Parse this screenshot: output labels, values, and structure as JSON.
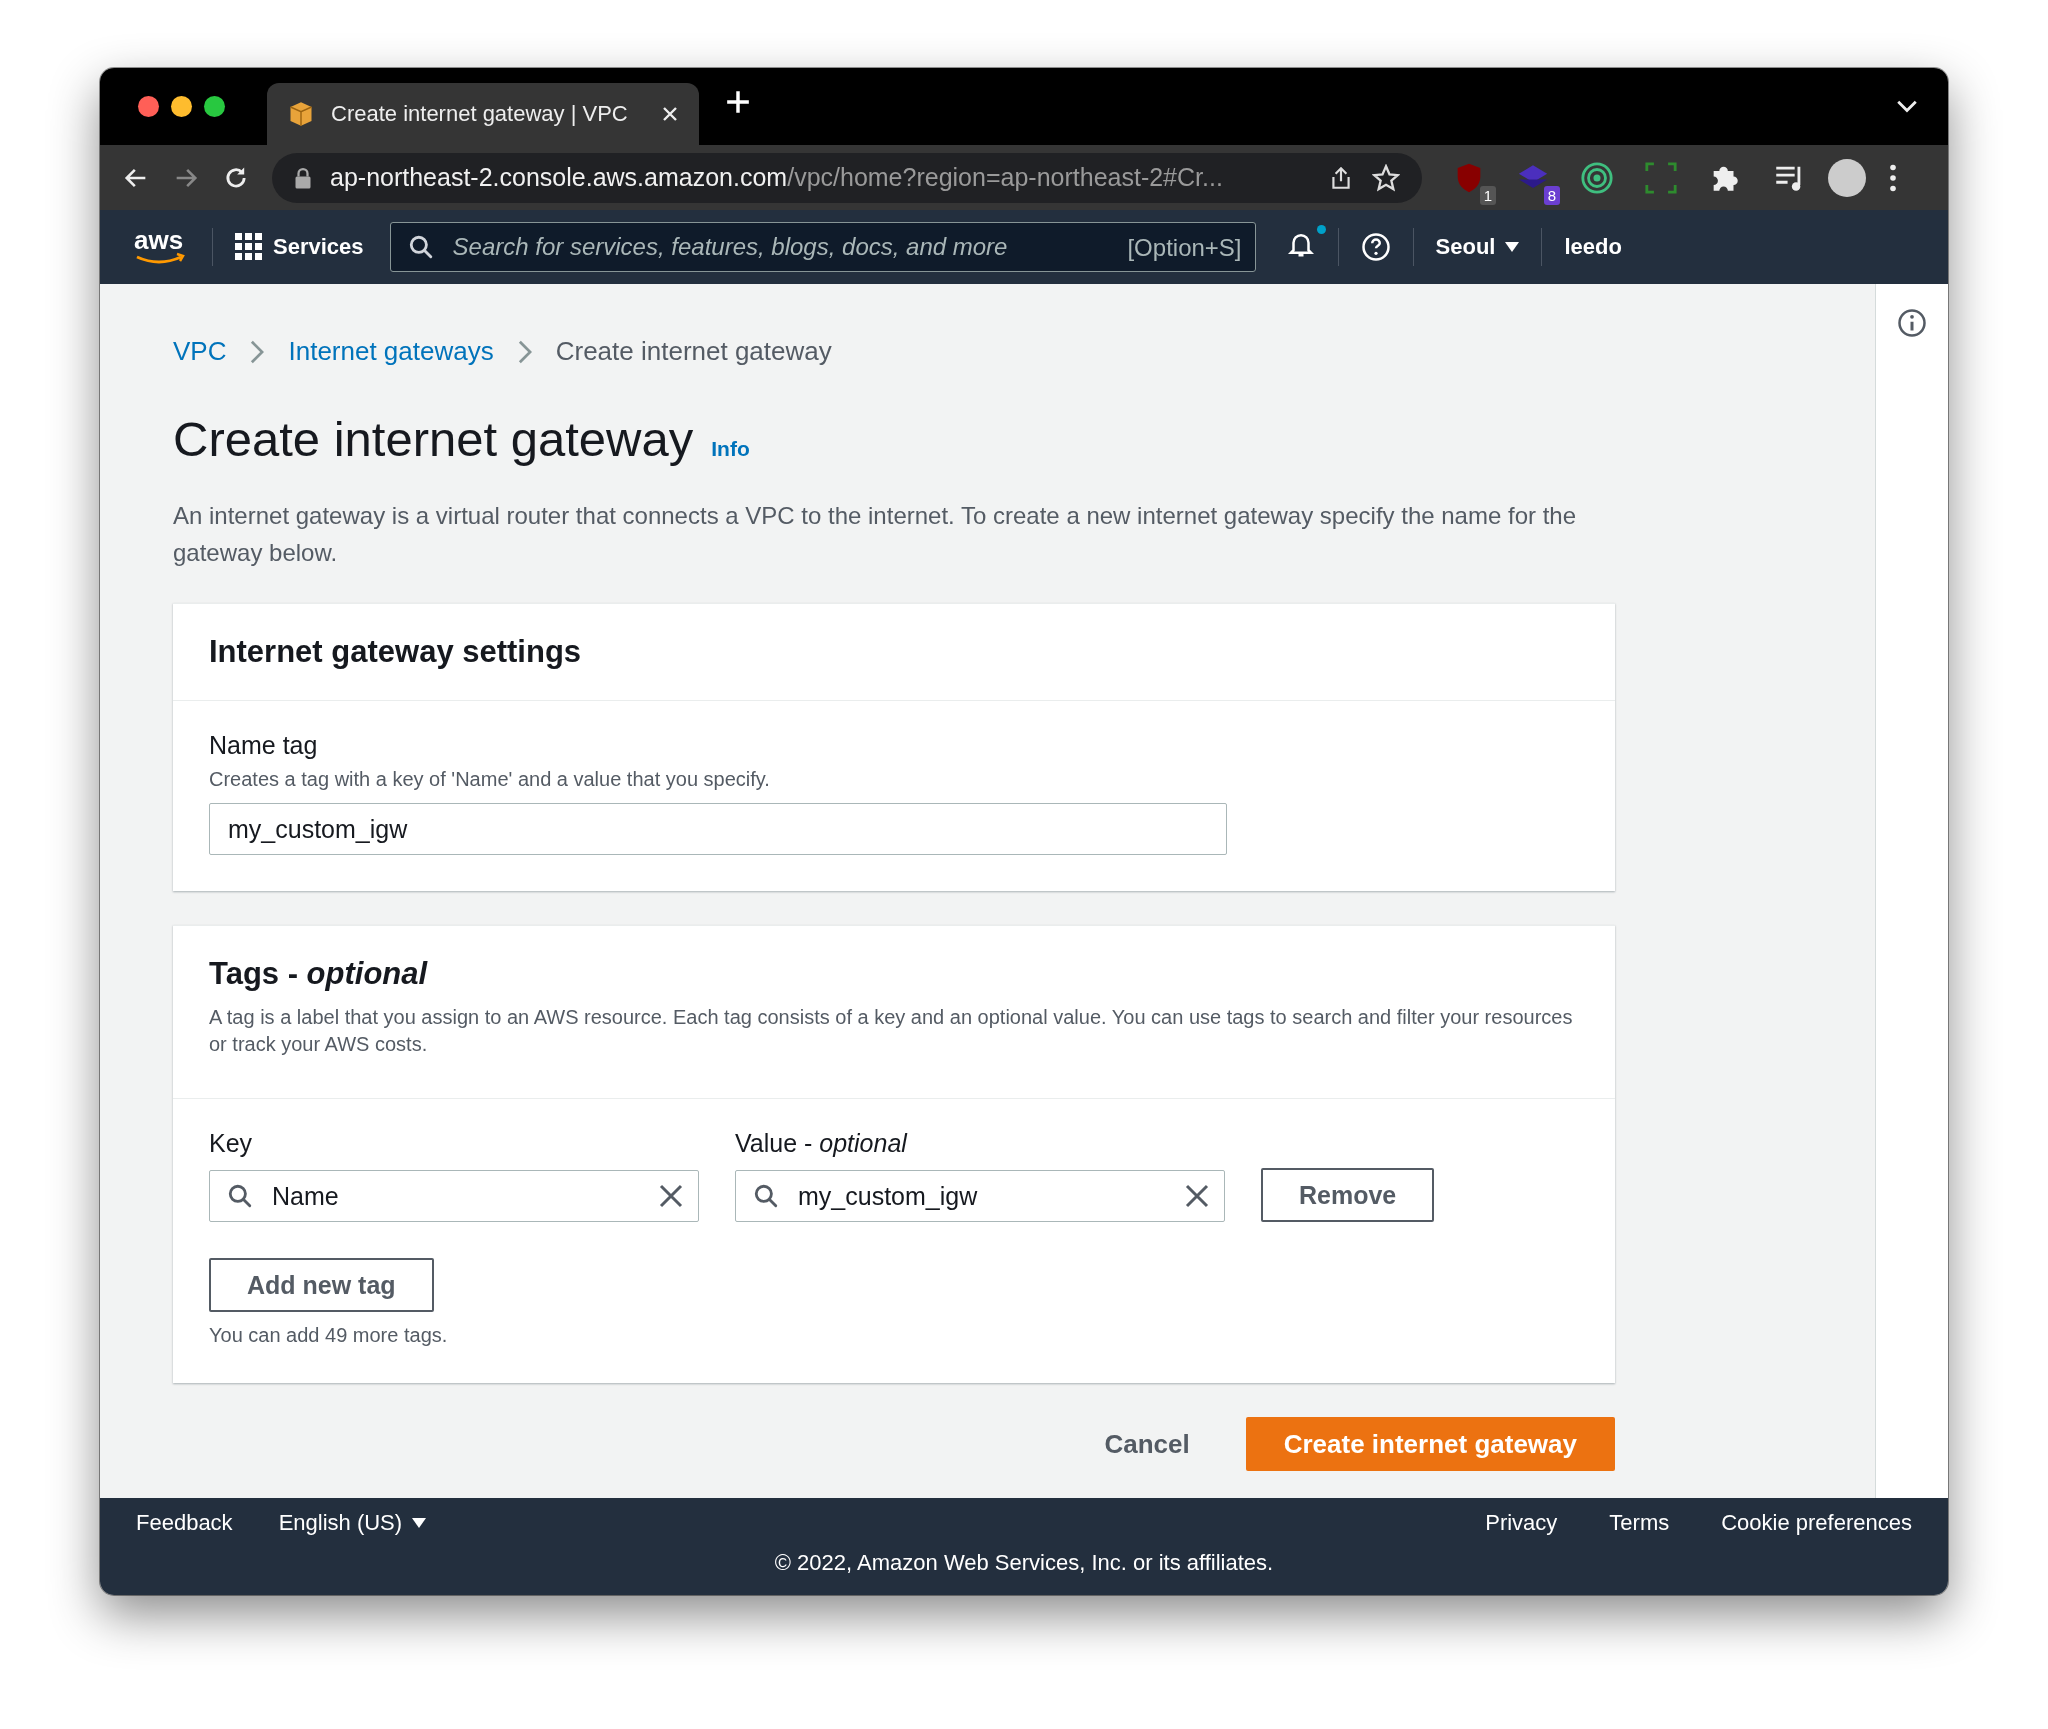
{
  "browser": {
    "tab": {
      "title": "Create internet gateway | VPC",
      "selected": true
    },
    "address": {
      "host": "ap-northeast-2.console.aws.amazon.com",
      "path": "/vpc/home?region=ap-northeast-2#Cr..."
    },
    "extensions": [
      {
        "kind": "shield",
        "badge": "1"
      },
      {
        "kind": "stack",
        "badge": "8"
      },
      {
        "kind": "target"
      },
      {
        "kind": "frame"
      },
      {
        "kind": "puzzle"
      },
      {
        "kind": "playlist"
      }
    ]
  },
  "console_nav": {
    "logo": "aws",
    "services": "Services",
    "search": {
      "placeholder": "Search for services, features, blogs, docs, and more",
      "shortcut": "[Option+S]"
    },
    "notifications_unread": true,
    "region": "Seoul",
    "user": "leedo"
  },
  "breadcrumbs": [
    {
      "label": "VPC",
      "link": true
    },
    {
      "label": "Internet gateways",
      "link": true
    },
    {
      "label": "Create internet gateway",
      "link": false
    }
  ],
  "title": "Create internet gateway",
  "info": "Info",
  "description": "An internet gateway is a virtual router that connects a VPC to the internet. To create a new internet gateway specify the name for the gateway below.",
  "settings": {
    "heading": "Internet gateway settings",
    "name_tag": {
      "label": "Name tag",
      "hint": "Creates a tag with a key of 'Name' and a value that you specify.",
      "value": "my_custom_igw"
    }
  },
  "tags": {
    "heading": "Tags - *optional*",
    "description": "A tag is a label that you assign to an AWS resource. Each tag consists of a key and an optional value. You can use tags to search and filter your resources or track your AWS costs.",
    "key_label": "Key",
    "value_label": "Value - *optional*",
    "rows": [
      {
        "key": "Name",
        "value": "my_custom_igw",
        "remove": "Remove"
      }
    ],
    "add": "Add new tag",
    "limit": "You can add 49 more tags."
  },
  "actions": {
    "cancel": "Cancel",
    "submit": "Create internet gateway"
  },
  "footer": {
    "feedback": "Feedback",
    "language": "English (US)",
    "links": [
      "Privacy",
      "Terms",
      "Cookie preferences"
    ],
    "copyright": "© 2022, Amazon Web Services, Inc. or its affiliates."
  }
}
